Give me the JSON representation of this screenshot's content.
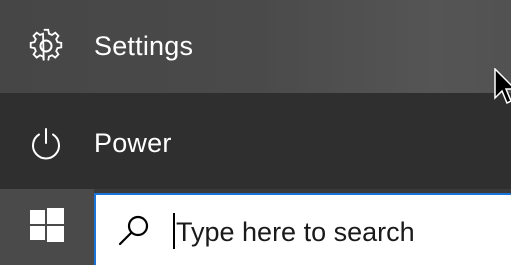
{
  "start_menu": {
    "items": [
      {
        "label": "Settings",
        "icon": "gear-icon"
      },
      {
        "label": "Power",
        "icon": "power-icon"
      }
    ]
  },
  "taskbar": {
    "start_icon": "windows-logo-icon",
    "search": {
      "icon": "search-icon",
      "placeholder": "Type here to search"
    }
  },
  "colors": {
    "settings_bg": "#4a4a4a",
    "power_bg": "#2f2f2f",
    "taskbar_bg": "#3a3a3a",
    "search_accent": "#1a73d9",
    "text": "#ffffff"
  }
}
